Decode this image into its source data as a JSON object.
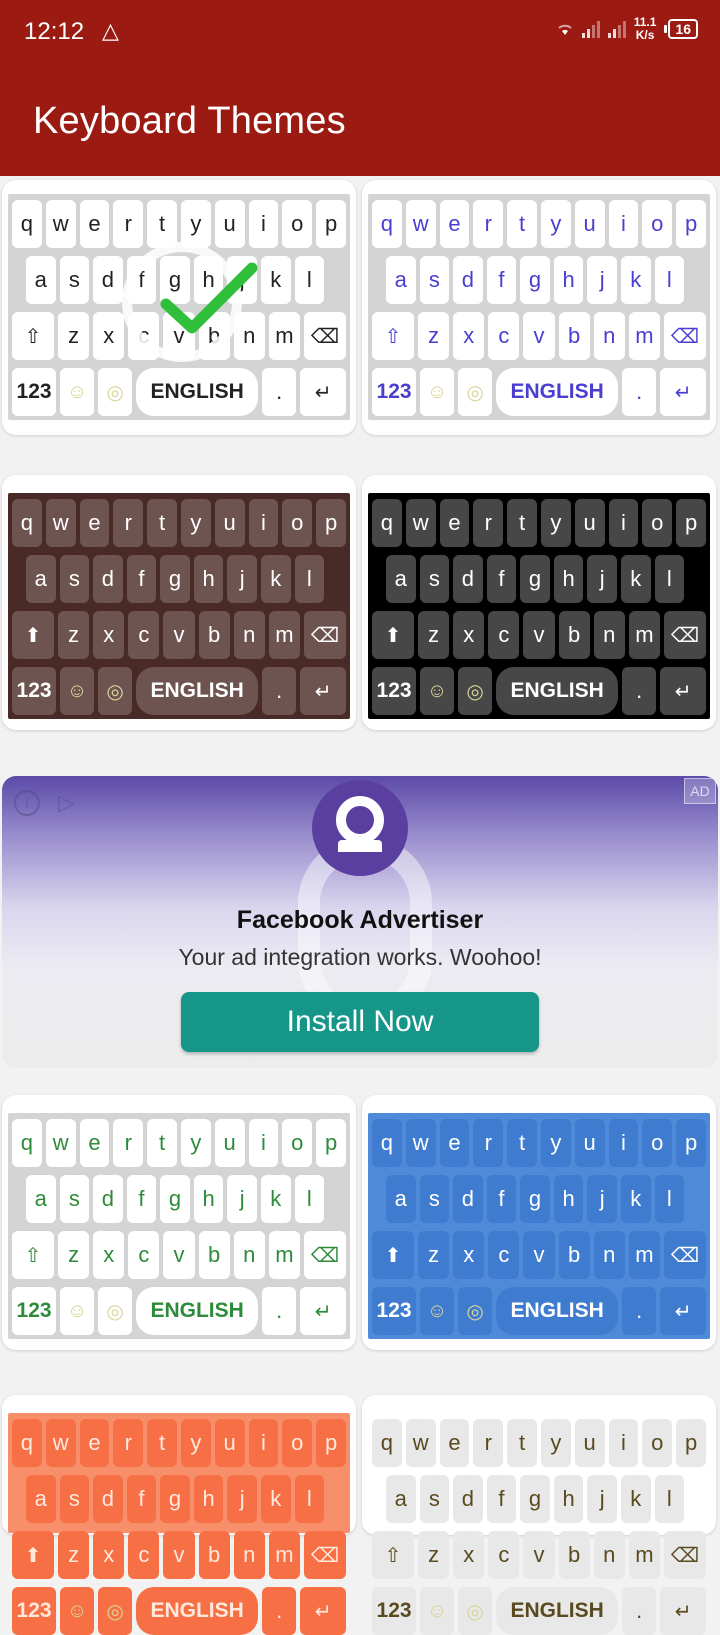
{
  "status_bar": {
    "time": "12:12",
    "alert_icon": "warning-triangle-icon",
    "net_speed_value": "11.1",
    "net_speed_unit": "K/s",
    "battery": "16"
  },
  "app_bar": {
    "title": "Keyboard Themes"
  },
  "keyboard_rows": {
    "row1": [
      "q",
      "w",
      "e",
      "r",
      "t",
      "y",
      "u",
      "i",
      "o",
      "p"
    ],
    "row2": [
      "a",
      "s",
      "d",
      "f",
      "g",
      "h",
      "j",
      "k",
      "l"
    ],
    "row3": [
      "z",
      "x",
      "c",
      "v",
      "b",
      "n",
      "m"
    ],
    "num_label": "123",
    "space_label": "ENGLISH",
    "period_label": "."
  },
  "themes": [
    {
      "id": "white-black",
      "selected": true,
      "bg": "#d4d4d4",
      "key": "#ffffff",
      "text": "#222222",
      "icon_style": "outline"
    },
    {
      "id": "white-blue",
      "selected": false,
      "bg": "#d4d4d4",
      "key": "#ffffff",
      "text": "#4a3fd0",
      "icon_style": "outline"
    },
    {
      "id": "brown",
      "selected": false,
      "bg": "#4a2a26",
      "key": "#6e5450",
      "text": "#ffffff",
      "icon_style": "solid"
    },
    {
      "id": "black",
      "selected": false,
      "bg": "#000000",
      "key": "#474747",
      "text": "#ffffff",
      "icon_style": "solid"
    },
    {
      "id": "white-green",
      "selected": false,
      "bg": "#d4d4d4",
      "key": "#ffffff",
      "text": "#2e8b3a",
      "icon_style": "outline"
    },
    {
      "id": "blue",
      "selected": false,
      "bg": "#4f8ad8",
      "key": "#3f7bcf",
      "text": "#ffffff",
      "icon_style": "solid"
    },
    {
      "id": "orange",
      "selected": false,
      "bg": "#f7906a",
      "key": "#f76f45",
      "text": "#ffe9dc",
      "icon_style": "solid"
    },
    {
      "id": "light-gray",
      "selected": false,
      "bg": "#ffffff",
      "key": "#e8e8e8",
      "text": "#5a4a20",
      "icon_style": "outline"
    }
  ],
  "ad": {
    "badge": "AD",
    "info_glyph": "i",
    "headline": "Facebook Advertiser",
    "body": "Your ad integration works. Woohoo!",
    "cta": "Install Now",
    "cta_color": "#159688"
  }
}
